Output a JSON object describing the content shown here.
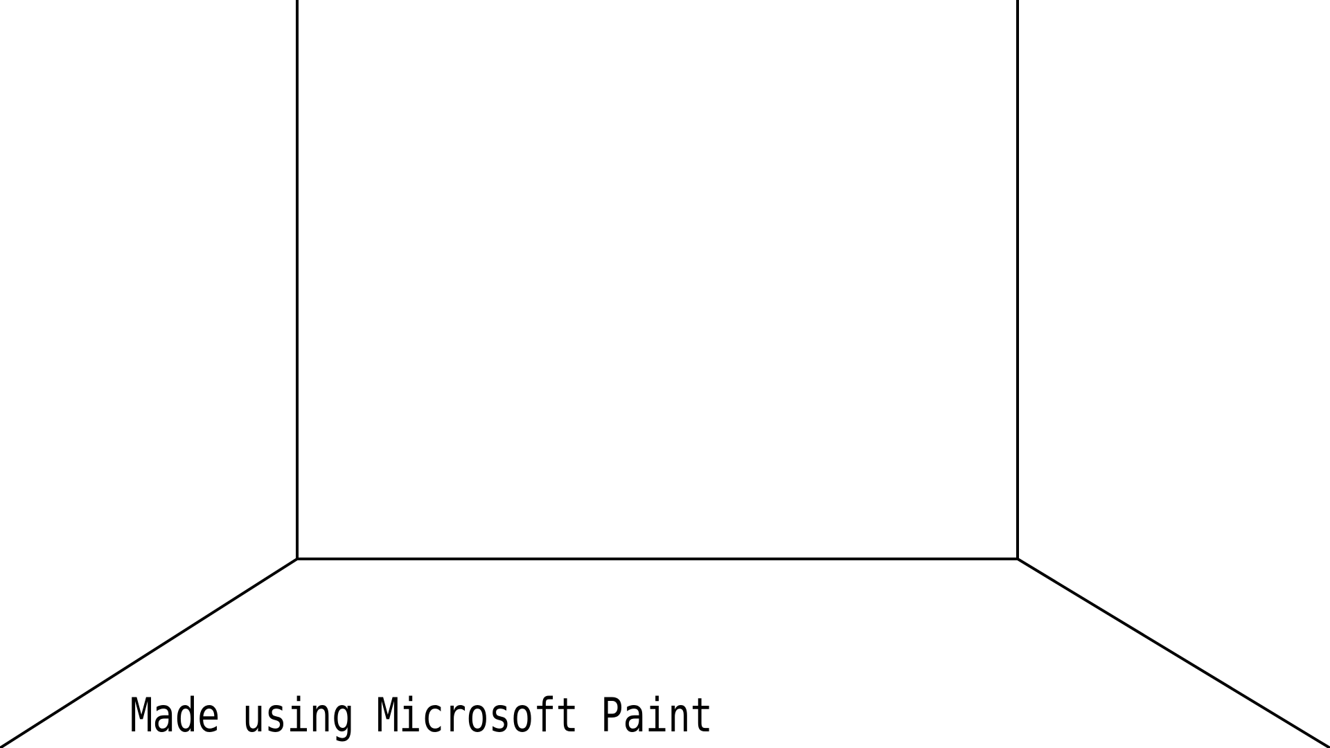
{
  "caption": "Made using Microsoft Paint",
  "colors": {
    "background": "#ffffff",
    "stroke": "#000000"
  }
}
